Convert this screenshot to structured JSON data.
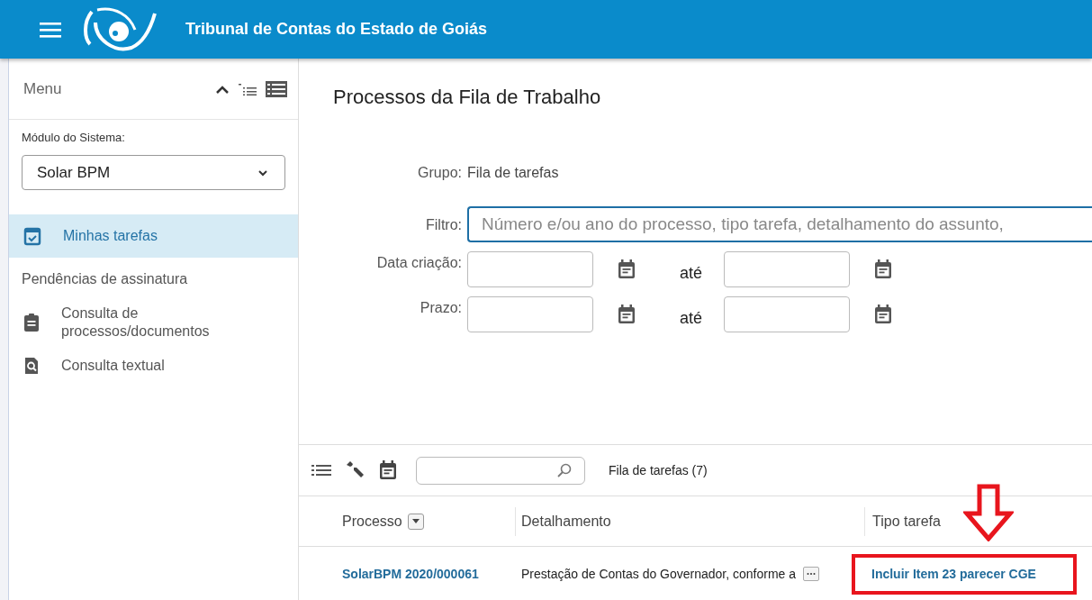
{
  "header": {
    "title": "Tribunal de Contas do Estado de Goiás"
  },
  "sidebar": {
    "title": "Menu",
    "module_label": "Módulo do Sistema:",
    "module_value": "Solar BPM",
    "items": [
      {
        "label": "Minhas tarefas",
        "kind": "calendar",
        "selected": true
      },
      {
        "label": "Pendências de assinatura",
        "kind": "plain",
        "selected": false
      },
      {
        "label": "Consulta de processos/documentos",
        "kind": "clipboard",
        "selected": false
      },
      {
        "label": "Consulta textual",
        "kind": "search-doc",
        "selected": false
      }
    ]
  },
  "page": {
    "title": "Processos da Fila de Trabalho",
    "group_label": "Grupo:",
    "group_value": "Fila de tarefas",
    "filter_label": "Filtro:",
    "filter_placeholder": "Número e/ou ano do processo, tipo tarefa, detalhamento do assunto,",
    "date_rows": [
      {
        "label": "Data criação:",
        "between": "até"
      },
      {
        "label": "Prazo:",
        "between": "até"
      }
    ]
  },
  "table": {
    "caption": "Fila de tarefas (7)",
    "columns": [
      "Processo",
      "Detalhamento",
      "Tipo tarefa"
    ],
    "rows": [
      {
        "processo": "SolarBPM 2020/000061",
        "detalhamento": "Prestação de Contas do Governador, conforme a",
        "tipo": "Incluir Item 23 parecer CGE",
        "highlighted": true
      }
    ]
  }
}
